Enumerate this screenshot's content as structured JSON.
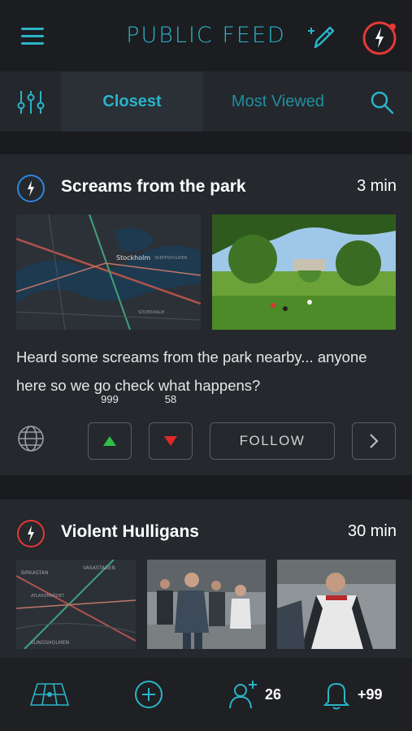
{
  "header": {
    "title": "PUBLIC FEED",
    "menu_icon": "hamburger-menu-icon",
    "edit_icon": "edit-pencil-icon",
    "alert_icon": "lightning-alert-icon",
    "accent_color": "#2ab4c8",
    "alert_color": "#e53935"
  },
  "tabs": {
    "filter_icon": "sliders-icon",
    "items": [
      {
        "label": "Closest",
        "active": true
      },
      {
        "label": "Most Viewed",
        "active": false
      }
    ],
    "search_icon": "search-icon"
  },
  "posts": [
    {
      "title": "Screams from the park",
      "time": "3 min",
      "type_color": "#2e86de",
      "images": [
        "map-thumbnail",
        "park-photo"
      ],
      "map_labels": [
        "Stockholm",
        "SKEPPSHOLMEN",
        "SÖDERMALM"
      ],
      "text": "Heard some screams from the park nearby... anyone here so we go check what happens?",
      "upvotes": "999",
      "downvotes": "58",
      "follow_label": "FOLLOW"
    },
    {
      "title": "Violent Hulligans",
      "time": "30 min",
      "type_color": "#e53935",
      "images": [
        "map-thumbnail",
        "running-people-photo",
        "running-man-photo"
      ],
      "map_labels": [
        "BIRKASTAN",
        "VASASTADEN",
        "ATLASOMRÅDET",
        "KUNGSHOLMEN"
      ]
    }
  ],
  "bottom_nav": {
    "items": [
      {
        "icon": "map-grid-icon"
      },
      {
        "icon": "add-circle-icon"
      },
      {
        "icon": "add-user-icon",
        "count": "26"
      },
      {
        "icon": "bell-icon",
        "count": "+99"
      }
    ]
  }
}
